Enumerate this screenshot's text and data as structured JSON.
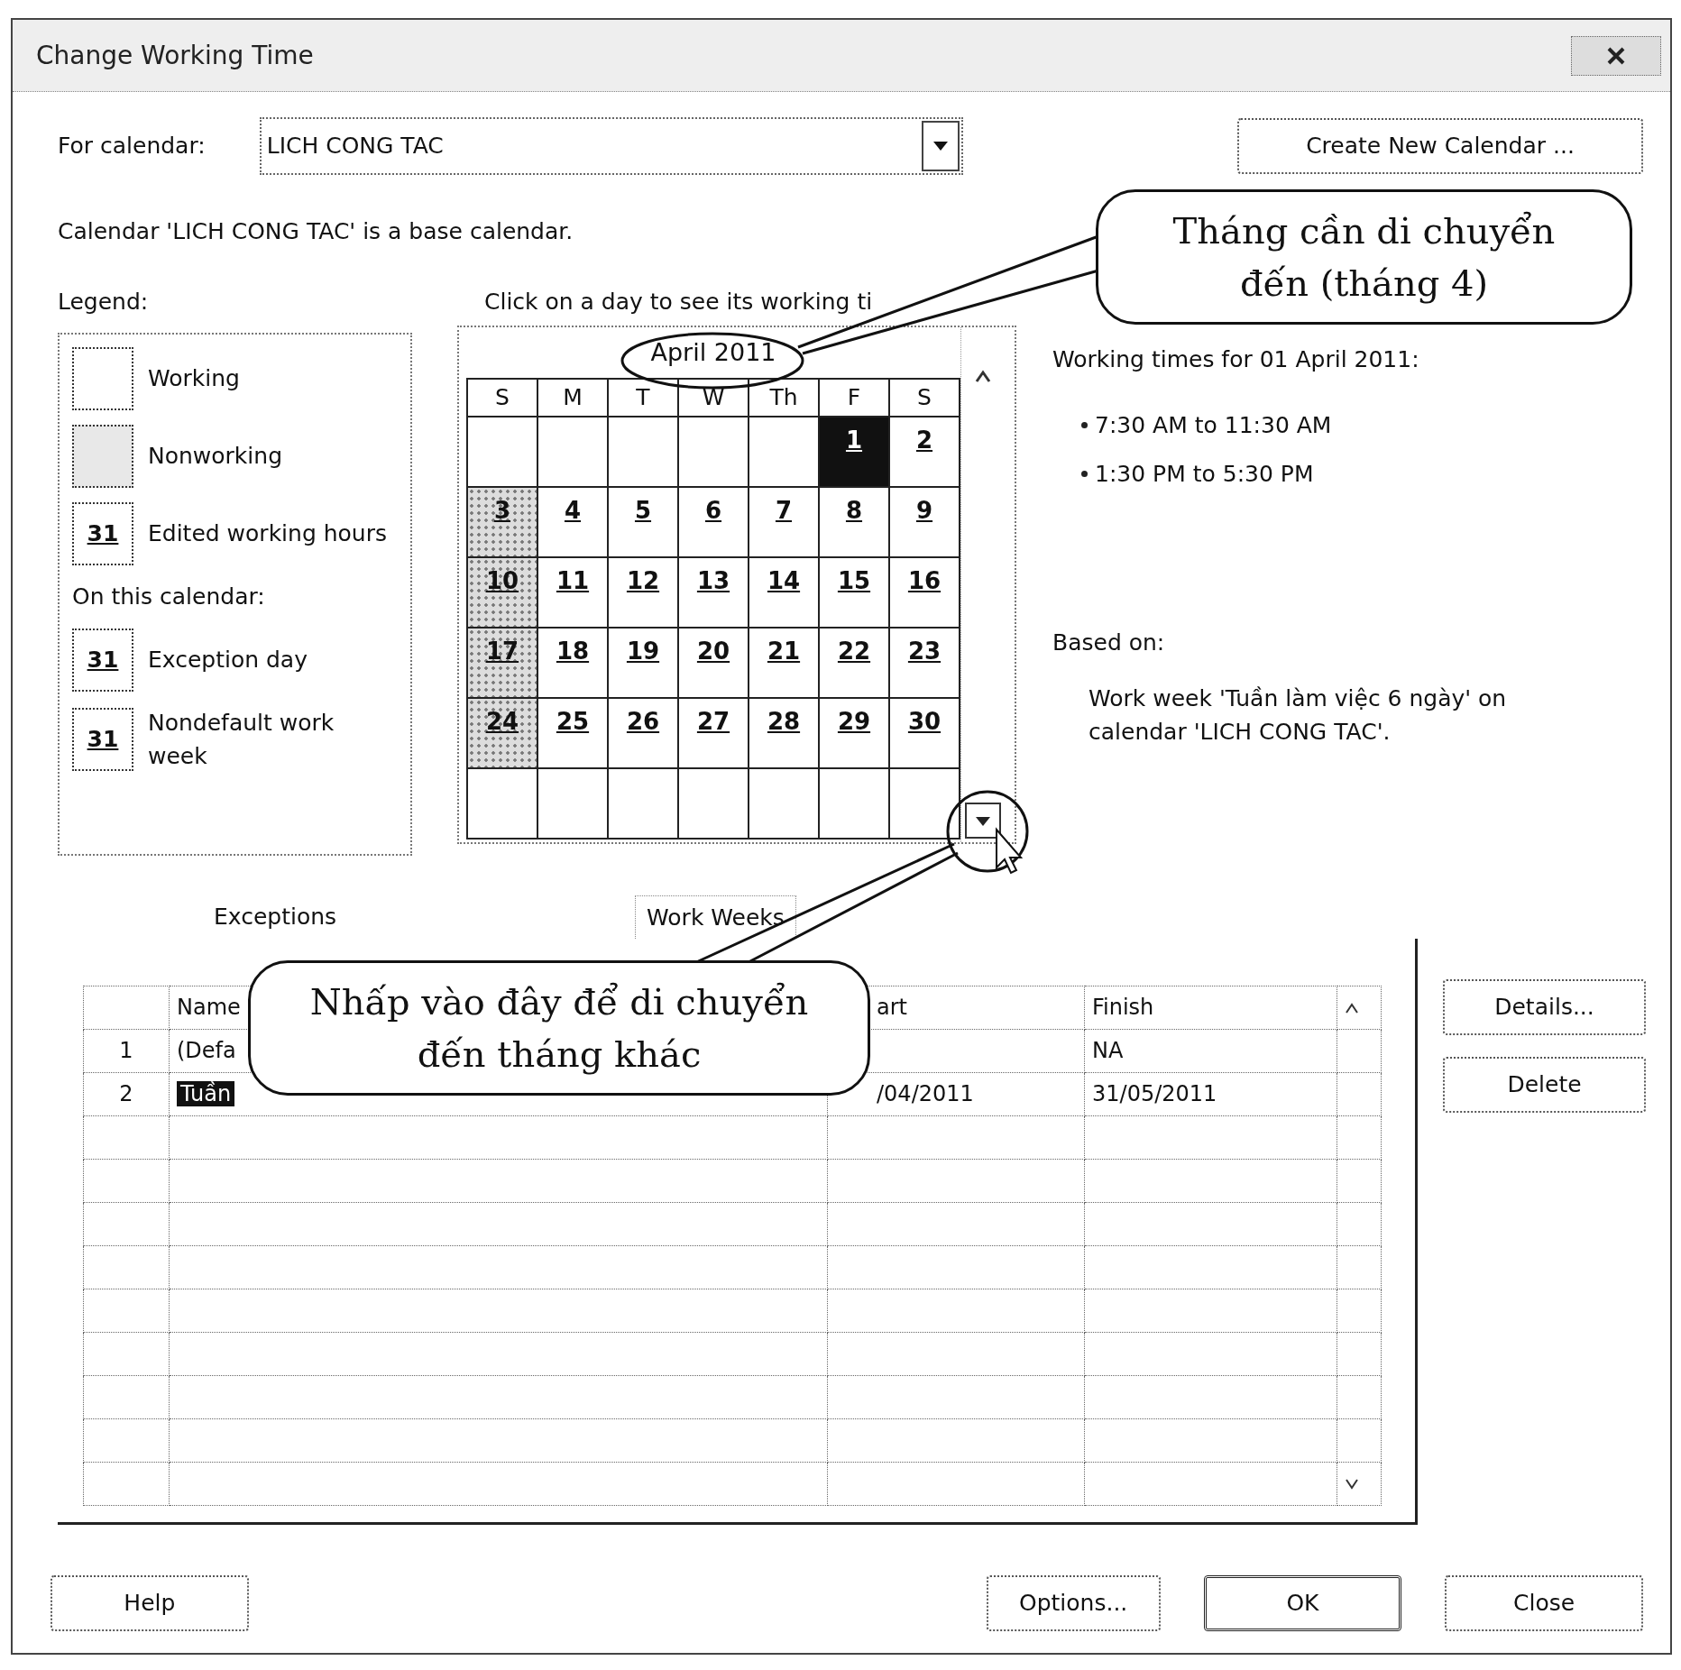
{
  "window": {
    "title": "Change Working Time"
  },
  "for_calendar": {
    "label": "For calendar:",
    "value": "LICH CONG TAC"
  },
  "create_button": "Create New Calendar ...",
  "calendar_note": "Calendar 'LICH CONG TAC' is a base calendar.",
  "legend": {
    "title": "Legend:",
    "groups": [
      {
        "items": [
          {
            "kind": "working",
            "label": "Working"
          },
          {
            "kind": "nonworking",
            "label": "Nonworking"
          },
          {
            "kind": "edited",
            "swatch": "31",
            "label": "Edited working hours"
          }
        ]
      },
      {
        "heading": "On this calendar:",
        "items": [
          {
            "kind": "exception",
            "swatch": "31",
            "label": "Exception day"
          },
          {
            "kind": "nondefault",
            "swatch": "31",
            "label": "Nondefault work week"
          }
        ]
      }
    ]
  },
  "calendar": {
    "caption": "Click on a day to see its working ti",
    "month": "April 2011",
    "weekdays": [
      "S",
      "M",
      "T",
      "W",
      "Th",
      "F",
      "S"
    ],
    "days_underlined": true,
    "weeks": [
      [
        {
          "kind": "blank"
        },
        {
          "kind": "blank"
        },
        {
          "kind": "blank"
        },
        {
          "kind": "blank"
        },
        {
          "kind": "blank"
        },
        {
          "day": "1",
          "selected": true,
          "nonworking": false
        },
        {
          "day": "2",
          "selected": false,
          "nonworking": false
        }
      ],
      [
        {
          "day": "3",
          "selected": false,
          "nonworking": true
        },
        {
          "day": "4",
          "selected": false,
          "nonworking": false
        },
        {
          "day": "5",
          "selected": false,
          "nonworking": false
        },
        {
          "day": "6",
          "selected": false,
          "nonworking": false
        },
        {
          "day": "7",
          "selected": false,
          "nonworking": false
        },
        {
          "day": "8",
          "selected": false,
          "nonworking": false
        },
        {
          "day": "9",
          "selected": false,
          "nonworking": false
        }
      ],
      [
        {
          "day": "10",
          "selected": false,
          "nonworking": true
        },
        {
          "day": "11",
          "selected": false,
          "nonworking": false
        },
        {
          "day": "12",
          "selected": false,
          "nonworking": false
        },
        {
          "day": "13",
          "selected": false,
          "nonworking": false
        },
        {
          "day": "14",
          "selected": false,
          "nonworking": false
        },
        {
          "day": "15",
          "selected": false,
          "nonworking": false
        },
        {
          "day": "16",
          "selected": false,
          "nonworking": false
        }
      ],
      [
        {
          "day": "17",
          "selected": false,
          "nonworking": true
        },
        {
          "day": "18",
          "selected": false,
          "nonworking": false
        },
        {
          "day": "19",
          "selected": false,
          "nonworking": false
        },
        {
          "day": "20",
          "selected": false,
          "nonworking": false
        },
        {
          "day": "21",
          "selected": false,
          "nonworking": false
        },
        {
          "day": "22",
          "selected": false,
          "nonworking": false
        },
        {
          "day": "23",
          "selected": false,
          "nonworking": false
        }
      ],
      [
        {
          "day": "24",
          "selected": false,
          "nonworking": true
        },
        {
          "day": "25",
          "selected": false,
          "nonworking": false
        },
        {
          "day": "26",
          "selected": false,
          "nonworking": false
        },
        {
          "day": "27",
          "selected": false,
          "nonworking": false
        },
        {
          "day": "28",
          "selected": false,
          "nonworking": false
        },
        {
          "day": "29",
          "selected": false,
          "nonworking": false
        },
        {
          "day": "30",
          "selected": false,
          "nonworking": false
        }
      ],
      [
        {
          "kind": "blank"
        },
        {
          "kind": "blank"
        },
        {
          "kind": "blank"
        },
        {
          "kind": "blank"
        },
        {
          "kind": "blank"
        },
        {
          "kind": "blank"
        },
        {
          "kind": "blank"
        }
      ]
    ]
  },
  "working_times": {
    "heading": "Working times for 01 April 2011:",
    "items": [
      "7:30 AM to 11:30 AM",
      "1:30 PM to 5:30 PM"
    ]
  },
  "based_on": {
    "heading": "Based on:",
    "text": "Work week 'Tuần làm việc 6 ngày' on calendar 'LICH CONG TAC'."
  },
  "tabs": [
    {
      "label": "Exceptions",
      "selected": false
    },
    {
      "label": "Work Weeks",
      "selected": true
    }
  ],
  "table": {
    "columns": [
      "Name",
      "art",
      "Finish"
    ],
    "rows": [
      {
        "number": "1",
        "name": "(Defa",
        "finish": "NA",
        "selected": false
      },
      {
        "number": "2",
        "name": "Tuần",
        "start": "/04/2011",
        "finish": "31/05/2011",
        "selected": true
      }
    ]
  },
  "side_buttons": [
    "Details...",
    "Delete"
  ],
  "buttons": [
    {
      "label": "Help",
      "default": false
    },
    {
      "label": "Options...",
      "default": false
    },
    {
      "label": "OK",
      "default": true
    },
    {
      "label": "Close",
      "default": false
    }
  ],
  "callouts": [
    {
      "text": "Tháng cần di chuyển đến (tháng 4)"
    },
    {
      "text": "Nhấp vào đây để di chuyển đến tháng khác"
    }
  ]
}
